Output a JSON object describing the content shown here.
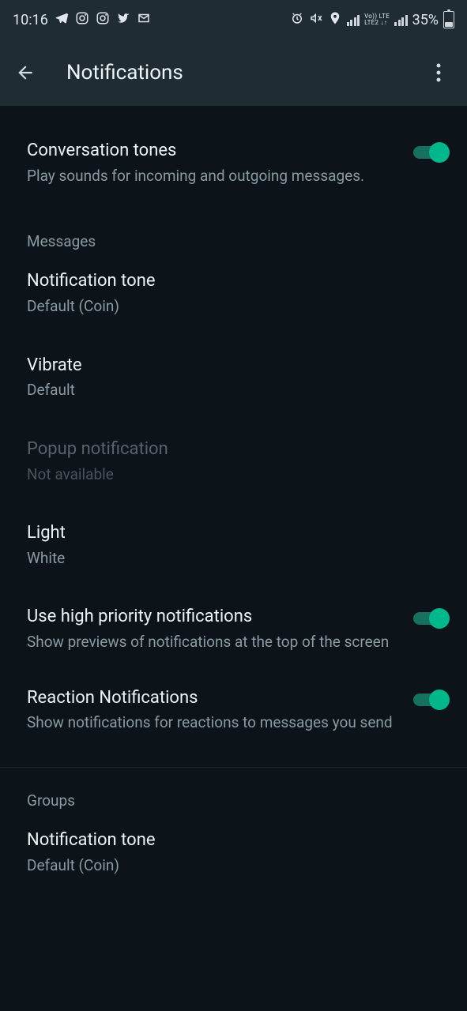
{
  "status_bar": {
    "time": "10:16",
    "battery_percent": "35%",
    "net_label_top": "Vo)) LTE",
    "net_label_bottom": "LTE2 ↓↑"
  },
  "app_bar": {
    "title": "Notifications"
  },
  "settings": {
    "conversation_tones": {
      "title": "Conversation tones",
      "sub": "Play sounds for incoming and outgoing messages."
    },
    "section_messages": "Messages",
    "notification_tone": {
      "title": "Notification tone",
      "sub": "Default (Coin)"
    },
    "vibrate": {
      "title": "Vibrate",
      "sub": "Default"
    },
    "popup": {
      "title": "Popup notification",
      "sub": "Not available"
    },
    "light": {
      "title": "Light",
      "sub": "White"
    },
    "high_priority": {
      "title": "Use high priority notifications",
      "sub": "Show previews of notifications at the top of the screen"
    },
    "reaction": {
      "title": "Reaction Notifications",
      "sub": "Show notifications for reactions to messages you send"
    },
    "section_groups": "Groups",
    "group_tone": {
      "title": "Notification tone",
      "sub": "Default (Coin)"
    }
  }
}
